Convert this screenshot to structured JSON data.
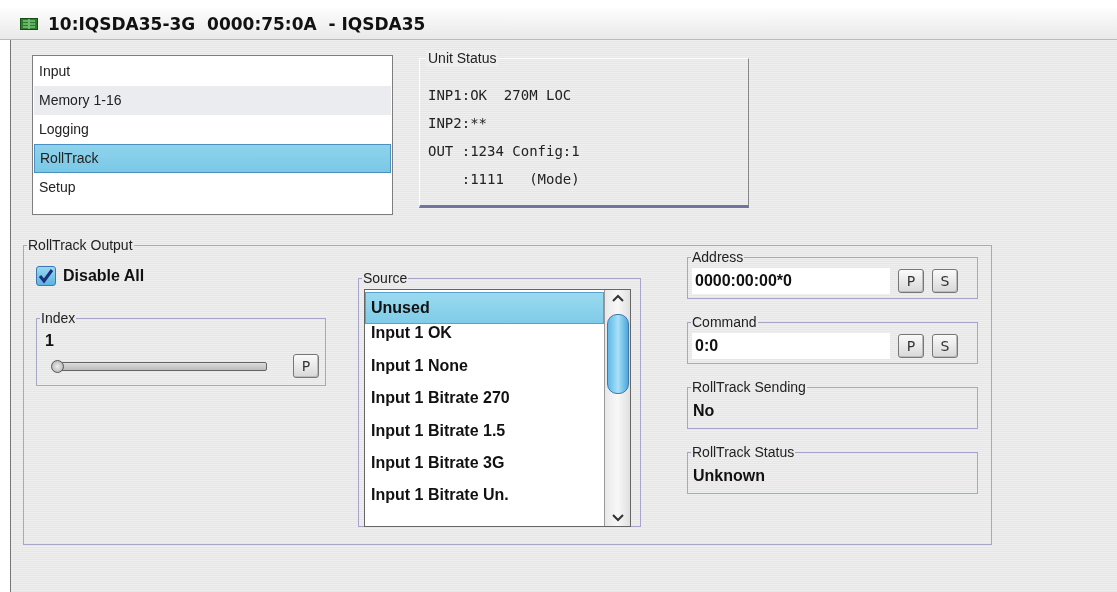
{
  "window": {
    "title": "10:IQSDA35-3G  0000:75:0A  - IQSDA35"
  },
  "menu": [
    {
      "label": "Input",
      "selected": false
    },
    {
      "label": "Memory 1-16",
      "selected": false
    },
    {
      "label": "Logging",
      "selected": false
    },
    {
      "label": "RollTrack",
      "selected": true
    },
    {
      "label": "Setup",
      "selected": false
    }
  ],
  "unit_status": {
    "title": "Unit Status",
    "lines": [
      "INP1:OK  270M LOC",
      "INP2:**",
      "OUT :1234 Config:1",
      "    :1111   (Mode)"
    ]
  },
  "rolltrack_output": {
    "title": "RollTrack Output",
    "disable_all": {
      "label": "Disable All",
      "checked": true
    },
    "index": {
      "title": "Index",
      "value": "1",
      "level": 0,
      "button": "P"
    },
    "source": {
      "title": "Source",
      "items": [
        {
          "label": "Unused",
          "selected": true
        },
        {
          "label": "Input 1 OK",
          "selected": false
        },
        {
          "label": "Input 1 None",
          "selected": false
        },
        {
          "label": "Input 1 Bitrate 270",
          "selected": false
        },
        {
          "label": "Input 1 Bitrate 1.5",
          "selected": false
        },
        {
          "label": "Input 1 Bitrate 3G",
          "selected": false
        },
        {
          "label": "Input 1 Bitrate Un.",
          "selected": false
        }
      ]
    },
    "address": {
      "title": "Address",
      "value": "0000:00:00*0",
      "buttons": [
        "P",
        "S"
      ]
    },
    "command": {
      "title": "Command",
      "value": "0:0",
      "buttons": [
        "P",
        "S"
      ]
    },
    "sending": {
      "title": "RollTrack Sending",
      "value": "No"
    },
    "status": {
      "title": "RollTrack Status",
      "value": "Unknown"
    }
  }
}
